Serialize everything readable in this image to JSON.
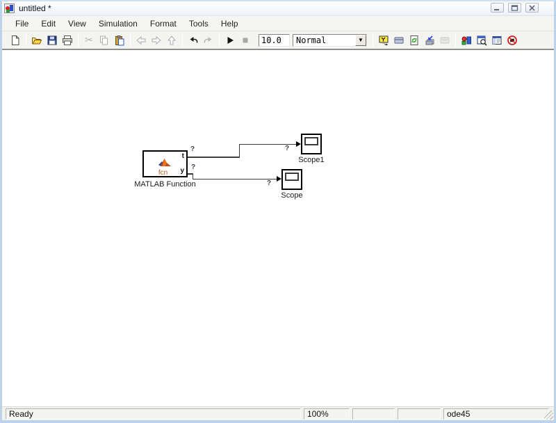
{
  "window": {
    "title": "untitled *",
    "app_icon": "simulink-model-icon"
  },
  "menu": {
    "items": [
      "File",
      "Edit",
      "View",
      "Simulation",
      "Format",
      "Tools",
      "Help"
    ]
  },
  "toolbar": {
    "sim_time": "10.0",
    "sim_mode": "Normal",
    "dropdown_arrow": "▼",
    "cut_glyph": "✂",
    "icons": [
      "new-document",
      "open-folder",
      "save-disk",
      "print",
      "cut",
      "copy",
      "paste",
      "back",
      "forward",
      "up",
      "undo",
      "redo",
      "start-simulation",
      "stop-simulation",
      "simulation-output",
      "model-configuration",
      "update-diagram",
      "build-model",
      "model-configuration-disabled",
      "simulink-library-browser",
      "model-explorer",
      "toggle-model-browser",
      "debug"
    ]
  },
  "canvas": {
    "unknown_marker": "?",
    "matlab_function": {
      "label": "MATLAB Function",
      "fcn": "fcn",
      "port_t": "t",
      "port_y": "y"
    },
    "scope1": {
      "label": "Scope1"
    },
    "scope": {
      "label": "Scope"
    }
  },
  "statusbar": {
    "status": "Ready",
    "zoom": "100%",
    "solver": "ode45"
  },
  "colors": {
    "window_border": "#bdd3ea",
    "toolbar_bg": "#f4f4f1",
    "canvas_bg": "#ffffff",
    "wire": "#3c3c3c",
    "matlab_orange": "#c05a20"
  }
}
